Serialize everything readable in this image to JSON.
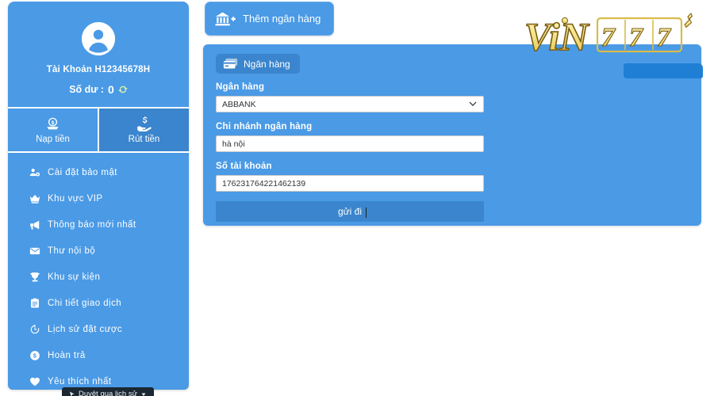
{
  "brand": {
    "logo_text": "ViN777",
    "logo_part1": "ViN",
    "logo_part2": "777",
    "gold": "#f4e48a",
    "gold_dark": "#8a6a14"
  },
  "theme": {
    "panel_blue": "#4a9ae6",
    "accent_dark_blue": "#3a85cd",
    "text_white": "#ffffff",
    "page_bg": "#ffffff"
  },
  "sidebar": {
    "avatar_icon": "user-circle-icon",
    "account_name": "Tài Khoản H12345678H",
    "balance_label": "Số dư :",
    "balance_value": "0",
    "refresh_icon": "refresh-icon",
    "tabs": [
      {
        "label": "Nạp tiền",
        "icon": "deposit-coin-icon",
        "active": false
      },
      {
        "label": "Rút tiền",
        "icon": "withdraw-hand-icon",
        "active": true
      }
    ],
    "items": [
      {
        "label": "Cài đặt bảo mật",
        "icon": "user-shield-icon"
      },
      {
        "label": "Khu vực VIP",
        "icon": "crown-icon"
      },
      {
        "label": "Thông báo mới nhất",
        "icon": "megaphone-icon"
      },
      {
        "label": "Thư nội bộ",
        "icon": "envelope-icon"
      },
      {
        "label": "Khu sự kiện",
        "icon": "trophy-icon"
      },
      {
        "label": "Chi tiết giao dịch",
        "icon": "clipboard-icon"
      },
      {
        "label": "Lịch sử đặt cược",
        "icon": "history-clock-icon"
      },
      {
        "label": "Hoàn trả",
        "icon": "dollar-circle-icon"
      },
      {
        "label": "Yêu thích nhất",
        "icon": "heart-icon"
      }
    ],
    "history_pill": {
      "label": "Duyệt qua lịch sử",
      "icon": "mouse-pointer-icon"
    }
  },
  "toolbar": {
    "add_bank_label": "Thêm ngân hàng",
    "add_bank_icon": "bank-plus-icon"
  },
  "form": {
    "badge_label": "Ngân hàng",
    "badge_icon": "credit-card-icon",
    "bank_label": "Ngân hàng",
    "bank_value": "ABBANK",
    "bank_options": [
      "ABBANK"
    ],
    "chevron_icon": "chevron-down-icon",
    "branch_label": "Chi nhánh ngân hàng",
    "branch_value": "hà nội",
    "account_label": "Số tài khoản",
    "account_value": "176231764221462139",
    "submit_label": "gửi đi"
  }
}
